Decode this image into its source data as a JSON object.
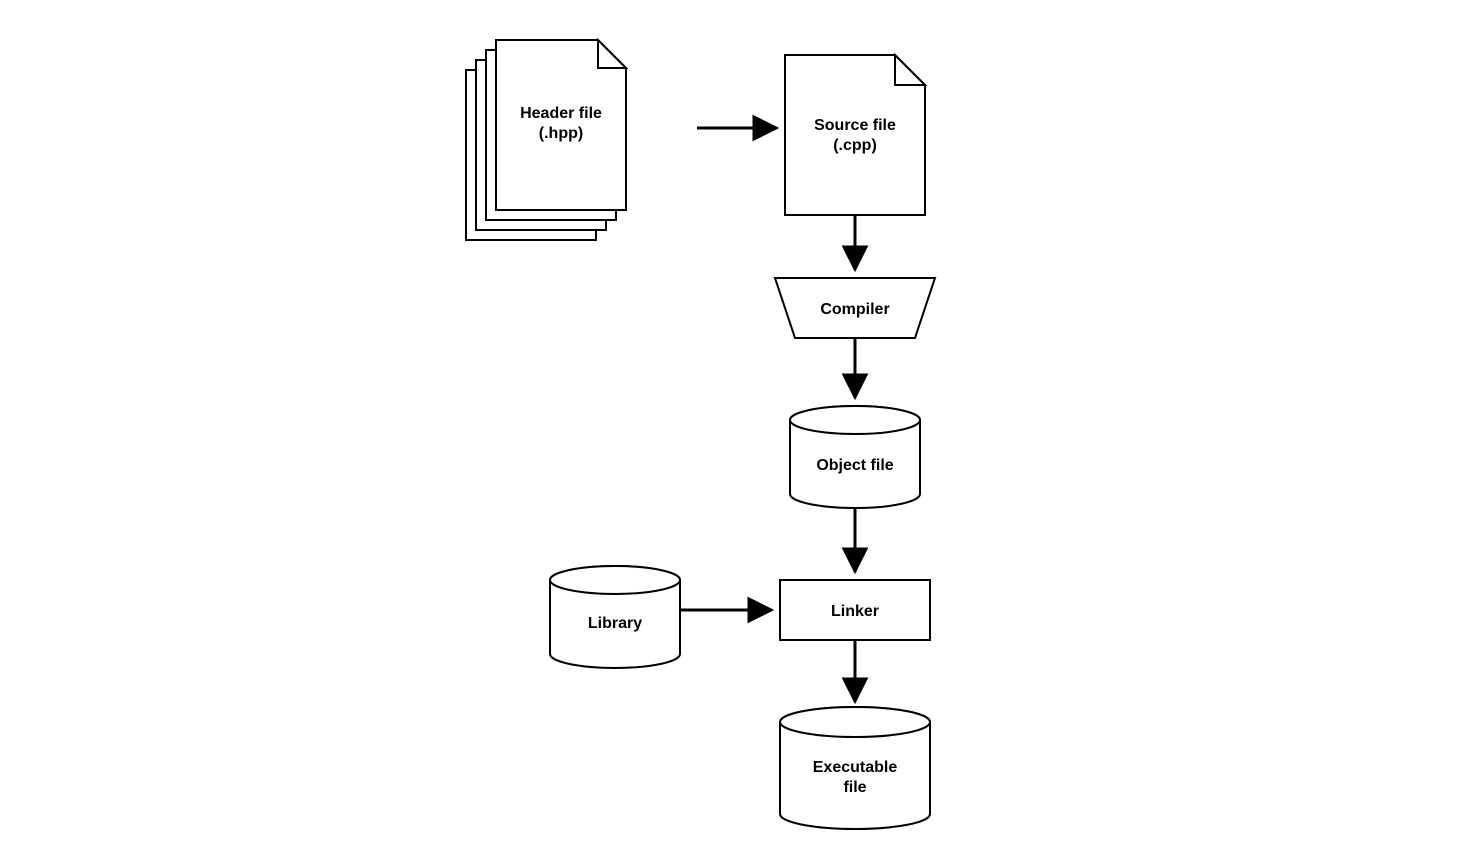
{
  "nodes": {
    "header_file": {
      "line1": "Header file",
      "line2": "(.hpp)"
    },
    "source_file": {
      "line1": "Source file",
      "line2": "(.cpp)"
    },
    "compiler": {
      "label": "Compiler"
    },
    "object_file": {
      "label": "Object file"
    },
    "library": {
      "label": "Library"
    },
    "linker": {
      "label": "Linker"
    },
    "executable": {
      "line1": "Executable",
      "line2": "file"
    }
  },
  "flow": [
    {
      "from": "header_file",
      "to": "source_file"
    },
    {
      "from": "source_file",
      "to": "compiler"
    },
    {
      "from": "compiler",
      "to": "object_file"
    },
    {
      "from": "object_file",
      "to": "linker"
    },
    {
      "from": "library",
      "to": "linker"
    },
    {
      "from": "linker",
      "to": "executable"
    }
  ]
}
